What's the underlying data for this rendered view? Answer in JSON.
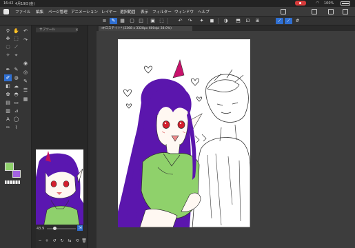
{
  "status_bar": {
    "time": "16:42",
    "date": "4月19日(金)",
    "battery": "100%"
  },
  "menu": {
    "items": [
      "ファイル",
      "編集",
      "ページ管理",
      "アニメーション",
      "レイヤー",
      "選択範囲",
      "表示",
      "フィルター",
      "ウィンドウ",
      "ヘルプ"
    ]
  },
  "subtool_panel": {
    "tab_label": "サブツール"
  },
  "document": {
    "tab_label": "キロステイト* (2368 x 3328px 600dpi 38.0%)"
  },
  "navigator": {
    "zoom": "43.9"
  },
  "colors": {
    "accent": "#2f6fd1",
    "foreground_color": "#8fd16b",
    "background_color": "#a463e2"
  },
  "icons": {
    "tools": [
      "zoom-icon",
      "hand-icon",
      "move-icon",
      "selection-icon",
      "lasso-icon",
      "eyedropper-icon",
      "pen-icon",
      "pencil-icon",
      "brush-icon",
      "airbrush-icon",
      "eraser-icon",
      "blend-icon",
      "fill-icon",
      "gradient-icon",
      "figure-icon",
      "text-icon",
      "balloon-icon",
      "ruler-icon"
    ]
  }
}
